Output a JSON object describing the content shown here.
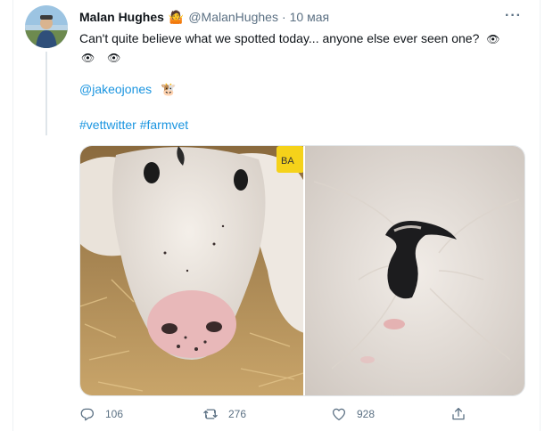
{
  "tweet": {
    "author_name": "Malan Hughes",
    "author_badge_emoji": "🤷",
    "handle": "@MalanHughes",
    "separator": "·",
    "date": "10 мая",
    "more_label": "···",
    "text": "Can't quite believe what we spotted today... anyone else ever seen one?",
    "eyes": [
      "👁",
      "👁",
      "👁"
    ],
    "mention": "@jakeojones",
    "mention_emoji": "🐮",
    "hashtags": "#vettwitter #farmvet",
    "ear_tag_text": "BA",
    "replies": "106",
    "retweets": "276",
    "likes": "928"
  },
  "icons": {
    "reply": "reply-icon",
    "retweet": "retweet-icon",
    "like": "heart-icon",
    "share": "share-icon",
    "more": "more-icon"
  },
  "colors": {
    "link": "#1b95e0",
    "secondary_text": "#5b7083",
    "primary_text": "#0f1419"
  }
}
